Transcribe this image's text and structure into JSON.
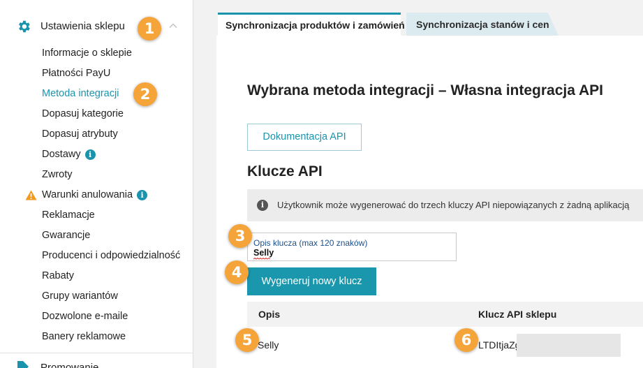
{
  "sidebar": {
    "section_title": "Ustawienia sklepu",
    "items": [
      {
        "label": "Informacje o sklepie"
      },
      {
        "label": "Płatności PayU"
      },
      {
        "label": "Metoda integracji"
      },
      {
        "label": "Dopasuj kategorie"
      },
      {
        "label": "Dopasuj atrybuty"
      },
      {
        "label": "Dostawy"
      },
      {
        "label": "Zwroty"
      },
      {
        "label": "Warunki anulowania"
      },
      {
        "label": "Reklamacje"
      },
      {
        "label": "Gwarancje"
      },
      {
        "label": "Producenci i odpowiedzialność"
      },
      {
        "label": "Rabaty"
      },
      {
        "label": "Grupy wariantów"
      },
      {
        "label": "Dozwolone e-maile"
      },
      {
        "label": "Banery reklamowe"
      }
    ],
    "bottom_label": "Promowanie"
  },
  "badges": [
    "1",
    "2",
    "3",
    "4",
    "5",
    "6"
  ],
  "tabs": {
    "active": "Synchronizacja produktów i zamówień",
    "inactive": "Synchronizacja stanów i cen"
  },
  "main": {
    "heading": "Wybrana metoda integracji – Własna integracja API",
    "doc_button": "Dokumentacja API",
    "keys_heading": "Klucze API",
    "info_text": "Użytkownik może wygenerować do trzech kluczy API niepowiązanych z żadną aplikacją",
    "description_label": "Opis klucza (max 120 znaków)",
    "description_value": "Selly",
    "generate_button": "Wygeneruj nowy klucz",
    "table": {
      "headers": [
        "Opis",
        "Klucz API sklepu"
      ],
      "rows": [
        {
          "opis": "Selly",
          "klucz": "LTDItjaZg"
        }
      ]
    }
  },
  "colors": {
    "accent": "#1a94ad",
    "badge": "#f5a43a",
    "info_bg": "#ececec"
  }
}
